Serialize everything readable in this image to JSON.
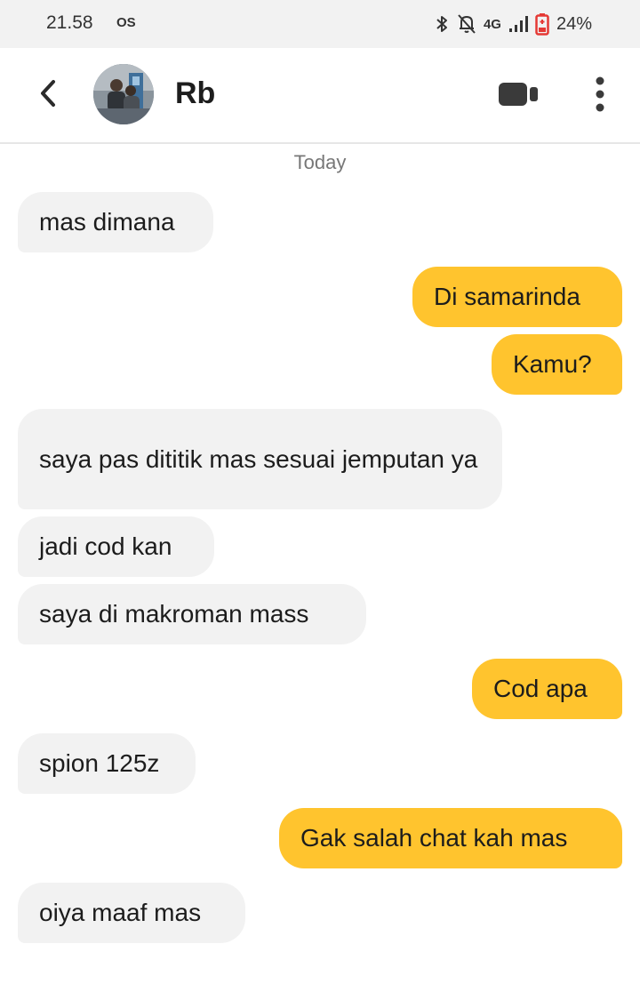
{
  "status_bar": {
    "time": "21.58",
    "os_label": "OS",
    "network": "4G",
    "battery": "24%",
    "icons": [
      "bluetooth-icon",
      "notifications-off-icon",
      "signal-icon",
      "battery-icon"
    ]
  },
  "header": {
    "contact_name": "Rb",
    "icons": [
      "back-icon",
      "avatar-photo",
      "video-call-icon",
      "more-options-icon"
    ]
  },
  "chat": {
    "date_label": "Today",
    "messages": [
      {
        "direction": "incoming",
        "text": "mas dimana"
      },
      {
        "direction": "outgoing",
        "text": "Di samarinda"
      },
      {
        "direction": "outgoing",
        "text": "Kamu?"
      },
      {
        "direction": "incoming",
        "text": "saya pas dititik mas sesuai jemputan ya"
      },
      {
        "direction": "incoming",
        "text": "jadi cod kan"
      },
      {
        "direction": "incoming",
        "text": "saya di makroman mass"
      },
      {
        "direction": "outgoing",
        "text": "Cod apa"
      },
      {
        "direction": "incoming",
        "text": "spion 125z"
      },
      {
        "direction": "outgoing",
        "text": "Gak salah chat kah mas"
      },
      {
        "direction": "incoming",
        "text": "oiya maaf mas"
      }
    ]
  },
  "colors": {
    "outgoing_bubble": "#ffc42e",
    "incoming_bubble": "#f2f2f2",
    "status_bar_bg": "#f2f2f2",
    "battery_low": "#e53935"
  }
}
